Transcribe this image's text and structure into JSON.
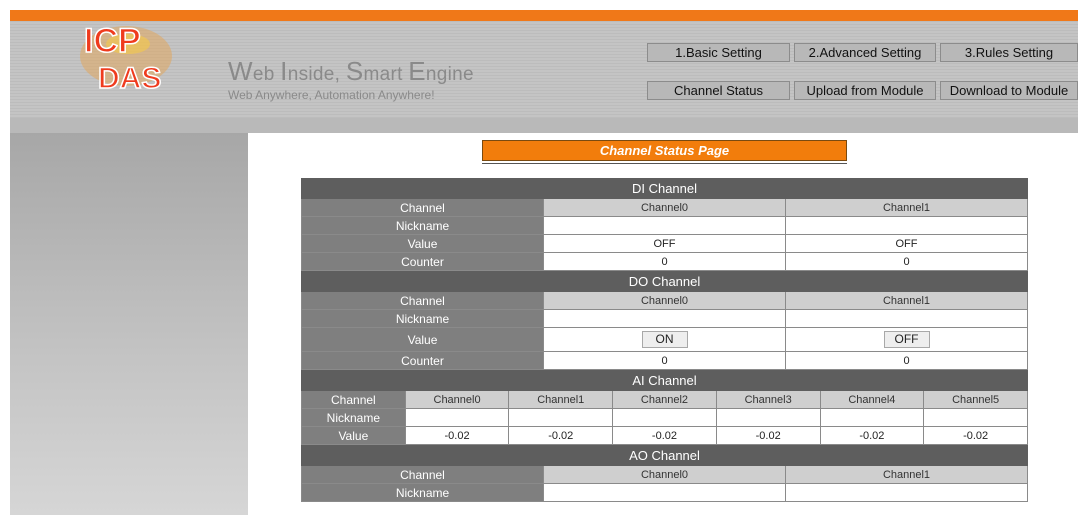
{
  "brand": {
    "logo_top": "ICP",
    "logo_bottom": "DAS",
    "tagline_words": [
      {
        "initial": "W",
        "rest": "eb"
      },
      {
        "initial": "I",
        "rest": "nside,"
      },
      {
        "initial": "S",
        "rest": "mart"
      },
      {
        "initial": "E",
        "rest": "ngine"
      }
    ],
    "subtitle": "Web Anywhere, Automation Anywhere!"
  },
  "nav": {
    "basic": "1.Basic Setting",
    "advanced": "2.Advanced Setting",
    "rules": "3.Rules Setting",
    "channel_status": "Channel Status",
    "upload": "Upload from Module",
    "download": "Download to Module"
  },
  "page_title": "Channel Status Page",
  "sections": {
    "di": {
      "title": "DI Channel",
      "labels": {
        "channel": "Channel",
        "nickname": "Nickname",
        "value": "Value",
        "counter": "Counter"
      },
      "channels": [
        "Channel0",
        "Channel1"
      ],
      "nicknames": [
        "",
        ""
      ],
      "values": [
        "OFF",
        "OFF"
      ],
      "counters": [
        "0",
        "0"
      ]
    },
    "do": {
      "title": "DO Channel",
      "labels": {
        "channel": "Channel",
        "nickname": "Nickname",
        "value": "Value",
        "counter": "Counter"
      },
      "channels": [
        "Channel0",
        "Channel1"
      ],
      "nicknames": [
        "",
        ""
      ],
      "values": [
        "ON",
        "OFF"
      ],
      "counters": [
        "0",
        "0"
      ]
    },
    "ai": {
      "title": "AI Channel",
      "labels": {
        "channel": "Channel",
        "nickname": "Nickname",
        "value": "Value"
      },
      "channels": [
        "Channel0",
        "Channel1",
        "Channel2",
        "Channel3",
        "Channel4",
        "Channel5"
      ],
      "nicknames": [
        "",
        "",
        "",
        "",
        "",
        ""
      ],
      "values": [
        "-0.02",
        "-0.02",
        "-0.02",
        "-0.02",
        "-0.02",
        "-0.02"
      ]
    },
    "ao": {
      "title": "AO Channel",
      "labels": {
        "channel": "Channel",
        "nickname": "Nickname"
      },
      "channels": [
        "Channel0",
        "Channel1"
      ],
      "nicknames": [
        "",
        ""
      ]
    }
  },
  "colors": {
    "accent_orange": "#f27d0c",
    "section_header": "#5e5e5e",
    "row_label": "#7f7f7f",
    "nav_button": "#b8b8b8"
  }
}
